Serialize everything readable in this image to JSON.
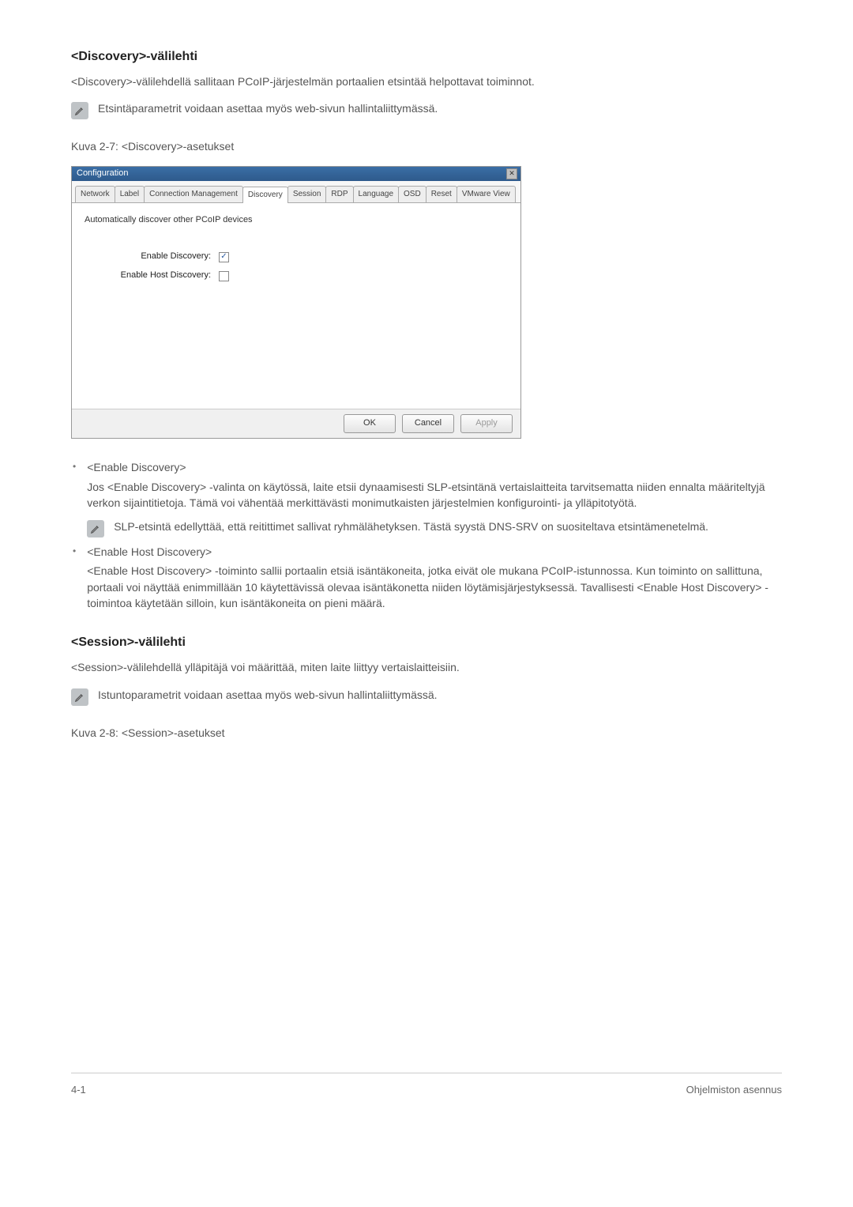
{
  "section1": {
    "heading": "<Discovery>-välilehti",
    "intro": "<Discovery>-välilehdellä sallitaan PCoIP-järjestelmän portaalien etsintää helpottavat toiminnot.",
    "note": "Etsintäparametrit voidaan asettaa myös web-sivun hallintaliittymässä.",
    "caption": "Kuva 2-7: <Discovery>-asetukset"
  },
  "dialog": {
    "title": "Configuration",
    "tabs": [
      "Network",
      "Label",
      "Connection Management",
      "Discovery",
      "Session",
      "RDP",
      "Language",
      "OSD",
      "Reset",
      "VMware View"
    ],
    "activeTab": "Discovery",
    "subtitle": "Automatically discover other PCoIP devices",
    "rows": [
      {
        "label": "Enable Discovery:",
        "checked": true
      },
      {
        "label": "Enable Host Discovery:",
        "checked": false
      }
    ],
    "buttons": {
      "ok": "OK",
      "cancel": "Cancel",
      "apply": "Apply"
    }
  },
  "bullets1": [
    {
      "title": "<Enable Discovery>",
      "para": "Jos <Enable Discovery> -valinta on käytössä, laite etsii dynaamisesti SLP-etsintänä vertaislaitteita tarvitsematta niiden ennalta määriteltyjä verkon sijaintitietoja. Tämä voi vähentää merkittävästi monimutkaisten järjestelmien konfigurointi- ja ylläpitotyötä.",
      "note": "SLP-etsintä edellyttää, että reitittimet sallivat ryhmälähetyksen. Tästä syystä DNS-SRV on suositeltava etsintämenetelmä."
    },
    {
      "title": "<Enable Host Discovery>",
      "para": "<Enable Host Discovery> -toiminto sallii portaalin etsiä isäntäkoneita, jotka eivät ole mukana PCoIP-istunnossa. Kun toiminto on sallittuna, portaali voi näyttää enimmillään 10 käytettävissä olevaa isäntäkonetta niiden löytämisjärjestyksessä. Tavallisesti <Enable Host Discovery> -toimintoa käytetään silloin, kun isäntäkoneita on pieni määrä."
    }
  ],
  "section2": {
    "heading": "<Session>-välilehti",
    "intro": "<Session>-välilehdellä ylläpitäjä voi määrittää, miten laite liittyy vertaislaitteisiin.",
    "note": "Istuntoparametrit voidaan asettaa myös web-sivun hallintaliittymässä.",
    "caption": "Kuva 2-8: <Session>-asetukset"
  },
  "footer": {
    "left": "4-1",
    "right": "Ohjelmiston asennus"
  }
}
